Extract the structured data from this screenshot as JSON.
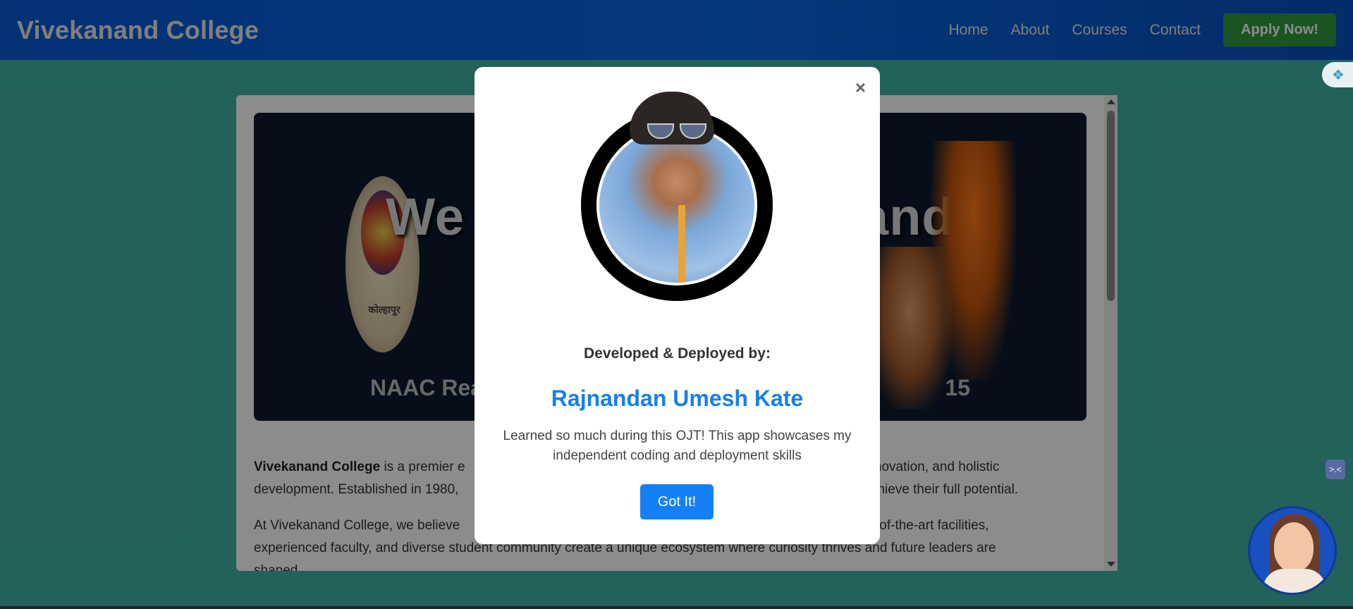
{
  "header": {
    "brand": "Vivekanand College",
    "nav": [
      "Home",
      "About",
      "Courses",
      "Contact"
    ],
    "apply_label": "Apply Now!"
  },
  "banner": {
    "title_left": "We",
    "title_right": "and",
    "subtitle_left": "NAAC Reaccred",
    "subtitle_right": "15",
    "logo_text": "कोल्हापूर"
  },
  "content": {
    "p1_bold": "Vivekanand College",
    "p1_left": "is a premier e",
    "p1_right": "innovation, and holistic",
    "p1_line2_left": "development. Established in 1980,    ",
    "p1_line2_right": "m to achieve their full potential.",
    "p2_line1_left": "At Vivekanand College, we believe",
    "p2_line1_right": "Our state-of-the-art facilities,",
    "p2_line2": "experienced faculty, and diverse student community create a unique ecosystem where curiosity thrives and future leaders are",
    "p2_line3": "shaped."
  },
  "modal": {
    "close_symbol": "×",
    "dev_label": "Developed & Deployed by:",
    "dev_name": "Rajnandan Umesh Kate",
    "message_line1": "Learned so much during this OJT! This app showcases my",
    "message_line2": "independent coding and deployment skills",
    "button_label": "Got It!"
  },
  "widgets": {
    "small_icon_text": ">.<"
  },
  "colors": {
    "header_blue": "#0a5ad6",
    "apply_green": "#2f9a3f",
    "page_teal": "#41b1a6",
    "name_blue": "#1a7fe8",
    "button_blue": "#1580f5"
  }
}
